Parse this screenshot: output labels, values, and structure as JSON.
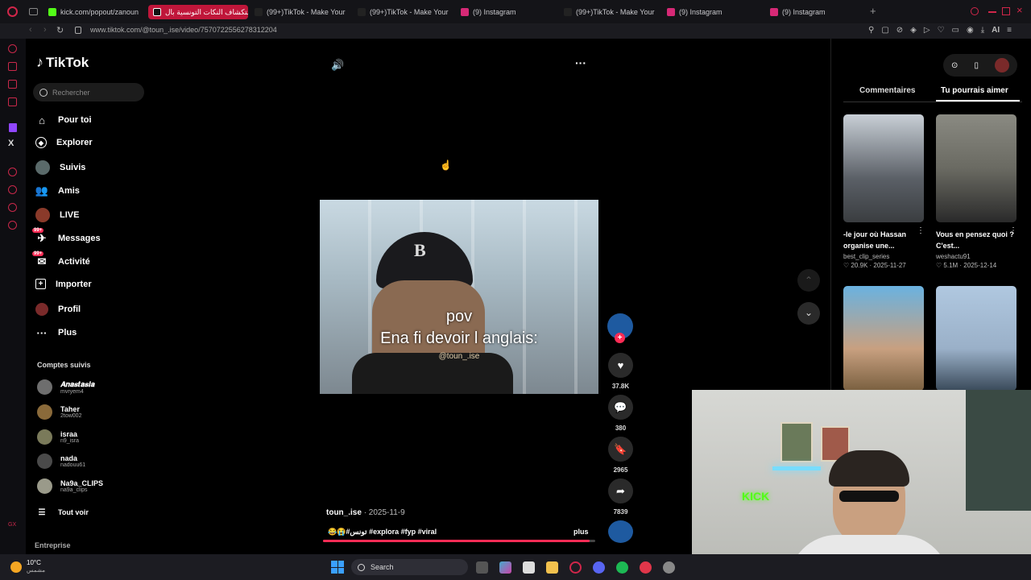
{
  "browser": {
    "tabs": [
      {
        "label": "kick.com/popout/zanoun"
      },
      {
        "label": "استكشاف النكات التونسية بال"
      },
      {
        "label": "(99+)TikTok - Make Your"
      },
      {
        "label": "(99+)TikTok - Make Your"
      },
      {
        "label": "(9) Instagram"
      },
      {
        "label": "(99+)TikTok - Make Your"
      },
      {
        "label": "(9) Instagram"
      },
      {
        "label": "(9) Instagram"
      }
    ],
    "url": "www.tiktok.com/@toun_.ise/video/7570722556278312204"
  },
  "tiktok": {
    "logo": "TikTok",
    "search_placeholder": "Rechercher",
    "nav": [
      {
        "label": "Pour toi",
        "icon": "home-icon"
      },
      {
        "label": "Explorer",
        "icon": "compass-icon"
      },
      {
        "label": "Suivis",
        "icon": "avatar"
      },
      {
        "label": "Amis",
        "icon": "friends-icon"
      },
      {
        "label": "LIVE",
        "icon": "avatar"
      },
      {
        "label": "Messages",
        "icon": "messages-icon",
        "badge": "99+"
      },
      {
        "label": "Activité",
        "icon": "activity-icon",
        "badge": "99+"
      },
      {
        "label": "Importer",
        "icon": "upload-icon"
      },
      {
        "label": "Profil",
        "icon": "avatar"
      },
      {
        "label": "Plus",
        "icon": "more-icon"
      }
    ],
    "following_title": "Comptes suivis",
    "following": [
      {
        "name": "𝑨𝒏𝒂𝒔𝒕𝒂𝒔𝒊𝒂",
        "handle": "mvryem4"
      },
      {
        "name": "Taher",
        "handle": "2tow002"
      },
      {
        "name": "israa",
        "handle": "n9_isra"
      },
      {
        "name": "nada",
        "handle": "nadouu61"
      },
      {
        "name": "Na9a_CLIPS",
        "handle": "na9a_clips"
      }
    ],
    "see_all": "Tout voir",
    "footer": "Entreprise"
  },
  "video": {
    "caption_line1": "pov",
    "caption_line2": "Ena fi devoir l anglais:",
    "watermark": "@toun_.ise",
    "author": "toun_.ise",
    "date": "· 2025-11-9",
    "description": "😂😭#تونس #explora #fyp #viral",
    "more": "plus",
    "likes": "37.8K",
    "comments": "380",
    "saves": "2965",
    "shares": "7839",
    "progress": 0.98
  },
  "right": {
    "tab_comments": "Commentaires",
    "tab_suggest": "Tu pourrais aimer",
    "cards": [
      {
        "title": "-le jour où Hassan organise une...",
        "user": "best_clip_series",
        "meta": "♡ 20.9K · 2025-11-27"
      },
      {
        "title": "Vous en pensez quoi ? C'est...",
        "user": "weshactu91",
        "meta": "♡ 5.1M · 2025-12-14"
      }
    ]
  },
  "webcam": {
    "sign": "KICK"
  },
  "taskbar": {
    "temp": "10°C",
    "weather": "مشمس",
    "search": "Search"
  },
  "colors": {
    "accent": "#fe2c55",
    "opera": "#c9284a"
  }
}
